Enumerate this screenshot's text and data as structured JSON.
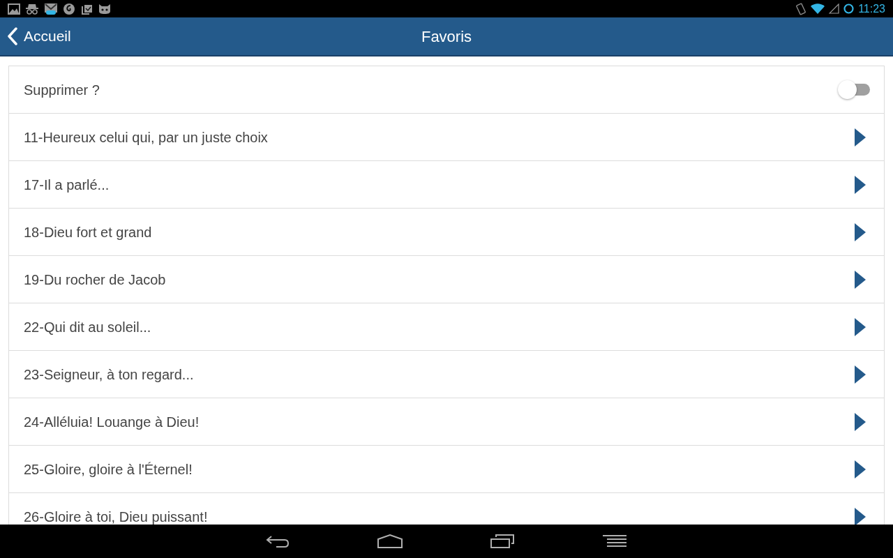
{
  "status_bar": {
    "time": "11:23"
  },
  "app_bar": {
    "back_label": "Accueil",
    "title": "Favoris"
  },
  "delete_toggle": {
    "label": "Supprimer ?",
    "on": false
  },
  "favorites": [
    {
      "title": "11-Heureux celui qui, par un juste choix"
    },
    {
      "title": "17-Il a parlé..."
    },
    {
      "title": "18-Dieu fort et grand"
    },
    {
      "title": "19-Du rocher de Jacob"
    },
    {
      "title": "22-Qui dit au soleil..."
    },
    {
      "title": "23-Seigneur, à ton regard..."
    },
    {
      "title": "24-Alléluia! Louange à Dieu!"
    },
    {
      "title": "25-Gloire, gloire à l'Éternel!"
    },
    {
      "title": "26-Gloire à toi, Dieu puissant!"
    }
  ]
}
